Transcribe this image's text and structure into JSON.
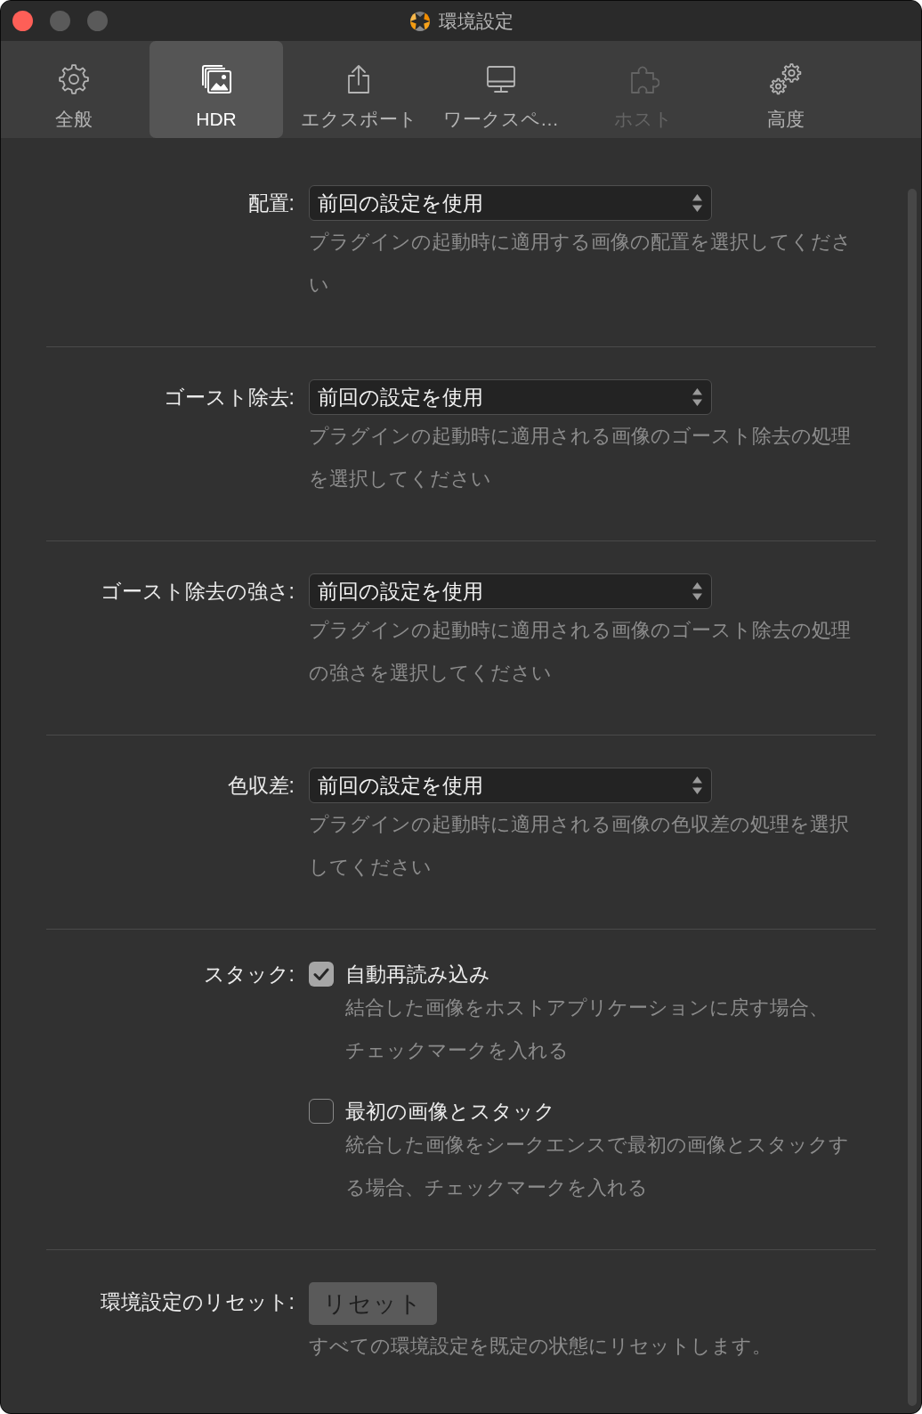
{
  "window": {
    "title": "環境設定",
    "controls": [
      {
        "kind": "close",
        "disabled": false
      },
      {
        "kind": "minimize",
        "disabled": true
      },
      {
        "kind": "zoom",
        "disabled": true
      }
    ]
  },
  "tabs": [
    {
      "label": "全般",
      "selected": false,
      "disabled": false
    },
    {
      "label": "HDR",
      "selected": true,
      "disabled": false
    },
    {
      "label": "エクスポート",
      "selected": false,
      "disabled": false
    },
    {
      "label": "ワークスペ…",
      "selected": false,
      "disabled": false
    },
    {
      "label": "ホスト",
      "selected": false,
      "disabled": true
    },
    {
      "label": "高度",
      "selected": false,
      "disabled": false
    }
  ],
  "settings": [
    {
      "kind": "select",
      "label": "配置:",
      "value": "前回の設定を使用",
      "description": "プラグインの起動時に適用する画像の配置を選択してください"
    },
    {
      "kind": "select",
      "label": "ゴースト除去:",
      "value": "前回の設定を使用",
      "description": "プラグインの起動時に適用される画像のゴースト除去の処理を選択してください"
    },
    {
      "kind": "select",
      "label": "ゴースト除去の強さ:",
      "value": "前回の設定を使用",
      "description": "プラグインの起動時に適用される画像のゴースト除去の処理の強さを選択してください"
    },
    {
      "kind": "select",
      "label": "色収差:",
      "value": "前回の設定を使用",
      "description": "プラグインの起動時に適用される画像の色収差の処理を選択してください"
    },
    {
      "kind": "checkboxes",
      "label": "スタック:",
      "options": [
        {
          "label": "自動再読み込み",
          "checked": true,
          "description": "結合した画像をホストアプリケーションに戻す場合、チェックマークを入れる"
        },
        {
          "label": "最初の画像とスタック",
          "checked": false,
          "description": "統合した画像をシークエンスで最初の画像とスタックする場合、チェックマークを入れる"
        }
      ]
    },
    {
      "kind": "button",
      "label": "環境設定のリセット:",
      "button": "リセット",
      "description": "すべての環境設定を既定の状態にリセットします。"
    }
  ]
}
